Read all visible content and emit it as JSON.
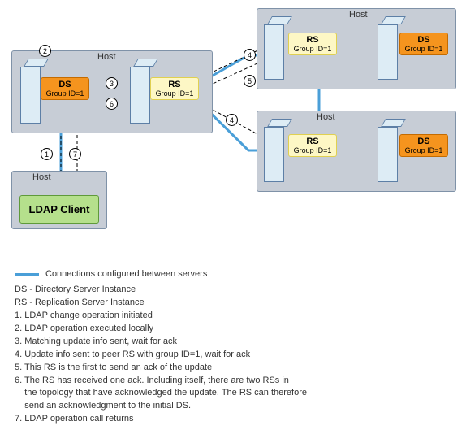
{
  "labels": {
    "host": "Host",
    "ds": "DS",
    "rs": "RS",
    "group": "Group ID=1",
    "ldap": "LDAP Client"
  },
  "steps": {
    "s1": "1",
    "s2": "2",
    "s3": "3",
    "s4": "4",
    "s5": "5",
    "s6": "6",
    "s7": "7"
  },
  "legend": {
    "conn": "Connections configured between servers",
    "ds_def": "DS - Directory Server Instance",
    "rs_def": "RS - Replication Server Instance",
    "l1": "1. LDAP change operation initiated",
    "l2": "2. LDAP operation executed locally",
    "l3": "3. Matching update info sent, wait for ack",
    "l4": "4. Update info sent to peer RS with group ID=1, wait for ack",
    "l5": "5. This RS is the first to send an ack of the update",
    "l6a": "6. The RS has received one ack. Including itself, there are two RSs in",
    "l6b": "    the topology that have acknowledged the update. The RS can therefore",
    "l6c": "    send an acknowledgment to the initial DS.",
    "l7": "7. LDAP operation call returns"
  }
}
